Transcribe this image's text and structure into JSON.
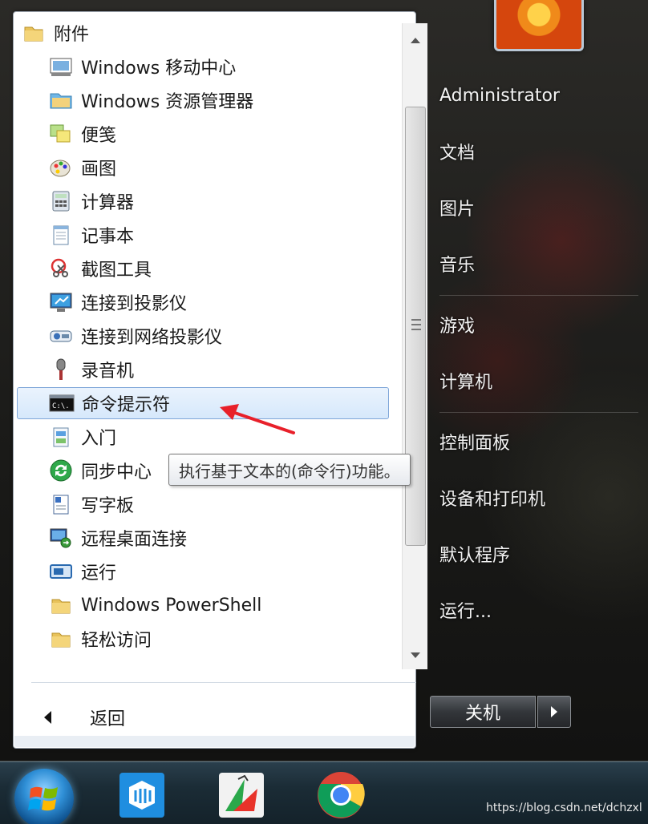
{
  "start_menu": {
    "programs": [
      {
        "label": "附件",
        "icon": "folder-icon"
      },
      {
        "label": "Windows 移动中心",
        "icon": "mobility-center-icon"
      },
      {
        "label": "Windows 资源管理器",
        "icon": "explorer-icon"
      },
      {
        "label": "便笺",
        "icon": "sticky-notes-icon"
      },
      {
        "label": "画图",
        "icon": "paint-icon"
      },
      {
        "label": "计算器",
        "icon": "calculator-icon"
      },
      {
        "label": "记事本",
        "icon": "notepad-icon"
      },
      {
        "label": "截图工具",
        "icon": "snipping-tool-icon"
      },
      {
        "label": "连接到投影仪",
        "icon": "projector-icon"
      },
      {
        "label": "连接到网络投影仪",
        "icon": "network-projector-icon"
      },
      {
        "label": "录音机",
        "icon": "microphone-icon"
      },
      {
        "label": "命令提示符",
        "icon": "cmd-icon",
        "selected": true
      },
      {
        "label": "入门",
        "icon": "getting-started-icon"
      },
      {
        "label": "同步中心",
        "icon": "sync-center-icon"
      },
      {
        "label": "写字板",
        "icon": "wordpad-icon"
      },
      {
        "label": "远程桌面连接",
        "icon": "remote-desktop-icon"
      },
      {
        "label": "运行",
        "icon": "run-icon"
      },
      {
        "label": "Windows PowerShell",
        "icon": "folder-icon"
      },
      {
        "label": "轻松访问",
        "icon": "folder-icon"
      }
    ],
    "back_label": "返回",
    "tooltip": "执行基于文本的(命令行)功能。"
  },
  "right_panel": {
    "user": "Administrator",
    "items": [
      "文档",
      "图片",
      "音乐",
      "游戏",
      "计算机",
      "控制面板",
      "设备和打印机",
      "默认程序",
      "运行..."
    ],
    "shutdown_label": "关机"
  },
  "watermark": "https://blog.csdn.net/dchzxl",
  "colors": {
    "selection_bg": "#d6e8fb",
    "selection_border": "#7fa6d8",
    "arrow": "#e8202a"
  }
}
